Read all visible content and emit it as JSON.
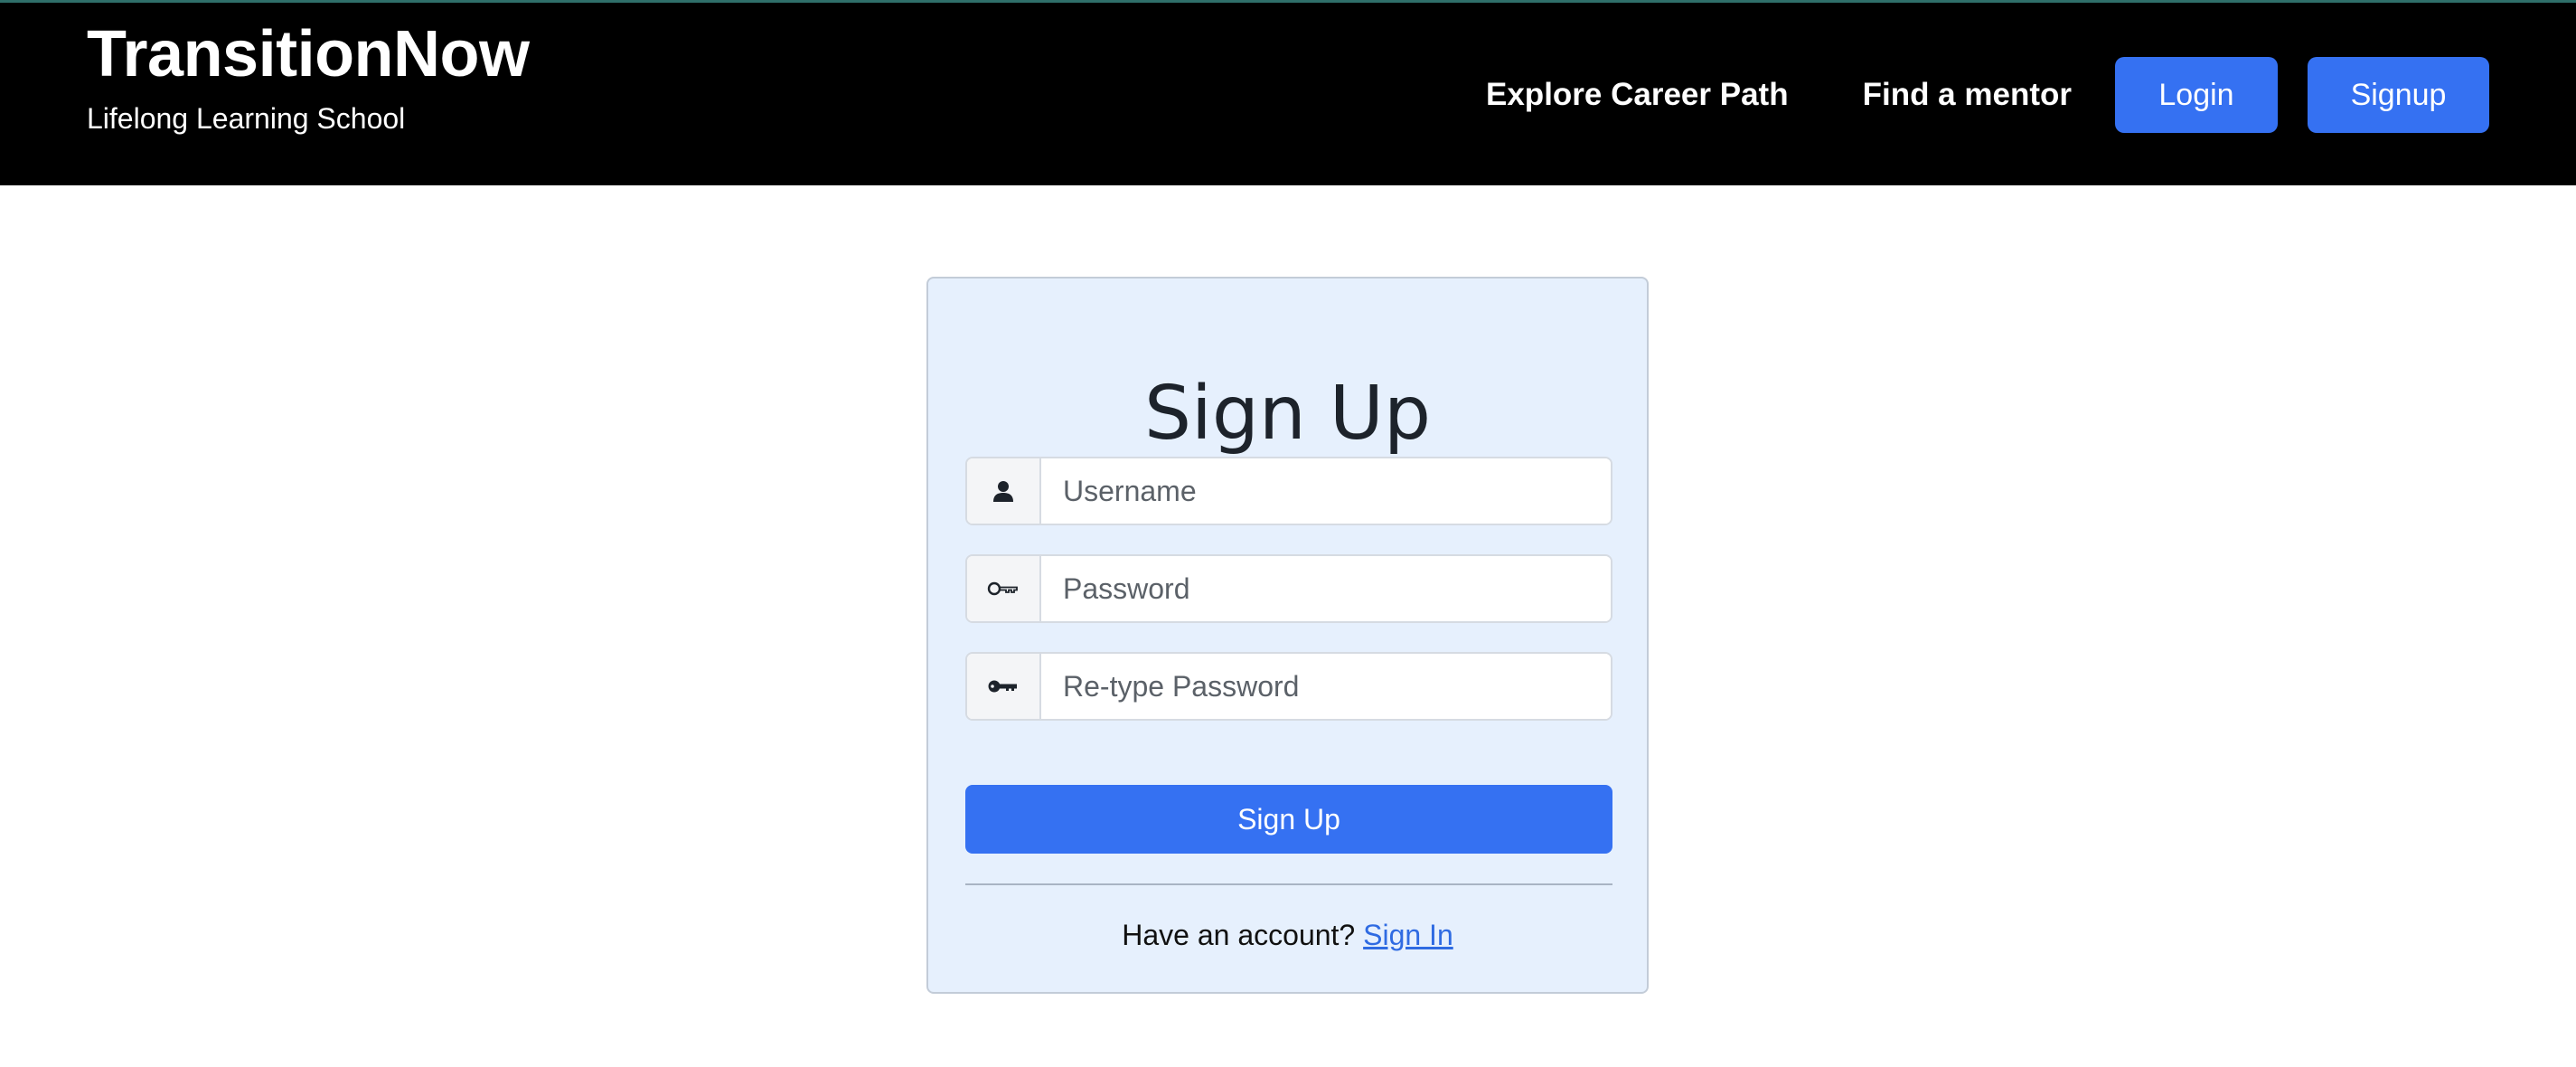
{
  "header": {
    "title": "TransitionNow",
    "subtitle": "Lifelong Learning School",
    "nav": {
      "explore": "Explore Career Path",
      "mentor": "Find a mentor",
      "login": "Login",
      "signup": "Signup"
    }
  },
  "form": {
    "title": "Sign Up",
    "fields": [
      {
        "icon": "user-icon",
        "placeholder": "Username",
        "value": ""
      },
      {
        "icon": "key-outline-icon",
        "placeholder": "Password",
        "value": ""
      },
      {
        "icon": "key-filled-icon",
        "placeholder": "Re-type Password",
        "value": ""
      }
    ],
    "submit_label": "Sign Up",
    "footer": {
      "prompt": "Have an account?",
      "link": "Sign In"
    }
  },
  "colors": {
    "header_bg": "#000000",
    "accent": "#3571f2",
    "card_bg": "#e6f0fd",
    "link": "#2f6be2"
  }
}
